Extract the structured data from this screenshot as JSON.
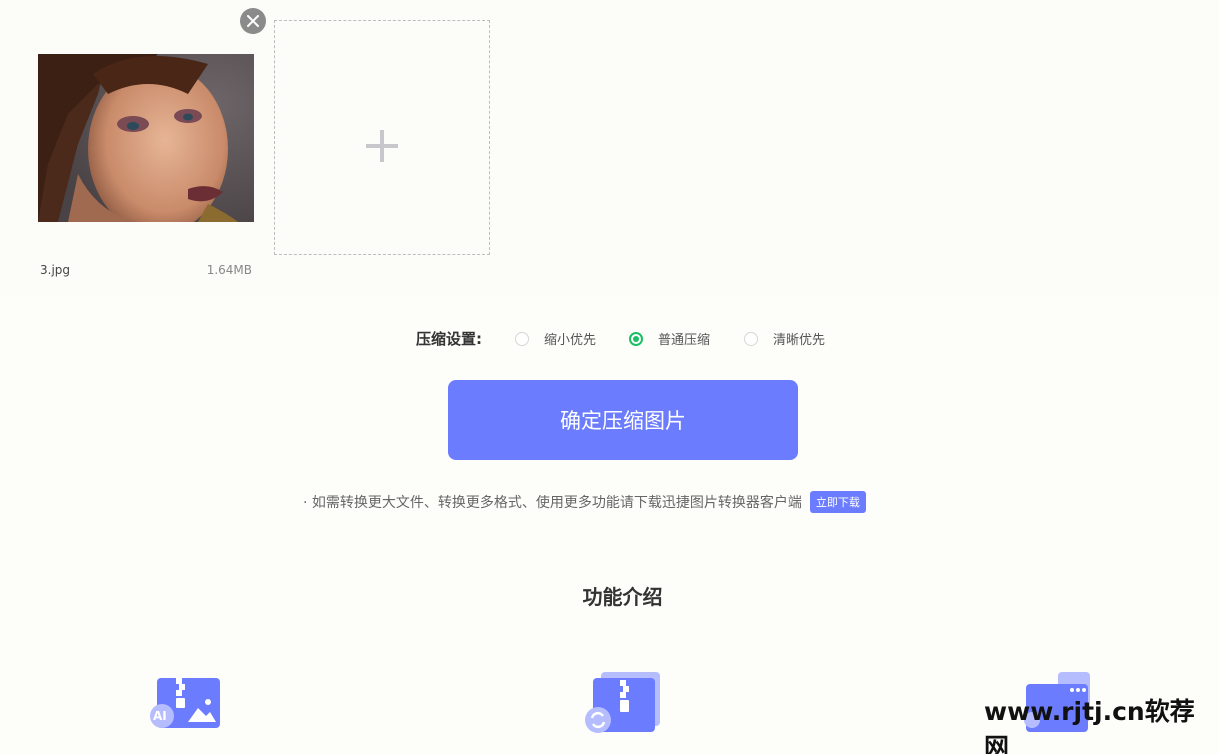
{
  "file": {
    "name": "3.jpg",
    "size": "1.64MB"
  },
  "settings": {
    "label": "压缩设置:",
    "options": [
      {
        "label": "缩小优先",
        "checked": false
      },
      {
        "label": "普通压缩",
        "checked": true
      },
      {
        "label": "清晰优先",
        "checked": false
      }
    ]
  },
  "actions": {
    "compress_label": "确定压缩图片",
    "download_label": "立即下载"
  },
  "notice": "· 如需转换更大文件、转换更多格式、使用更多功能请下载迅捷图片转换器客户端",
  "features": {
    "title": "功能介绍",
    "ai_badge": "AI"
  },
  "watermark": "www.rjtj.cn软荐网",
  "colors": {
    "accent": "#6b7cff",
    "radio_checked": "#1bbf64"
  }
}
